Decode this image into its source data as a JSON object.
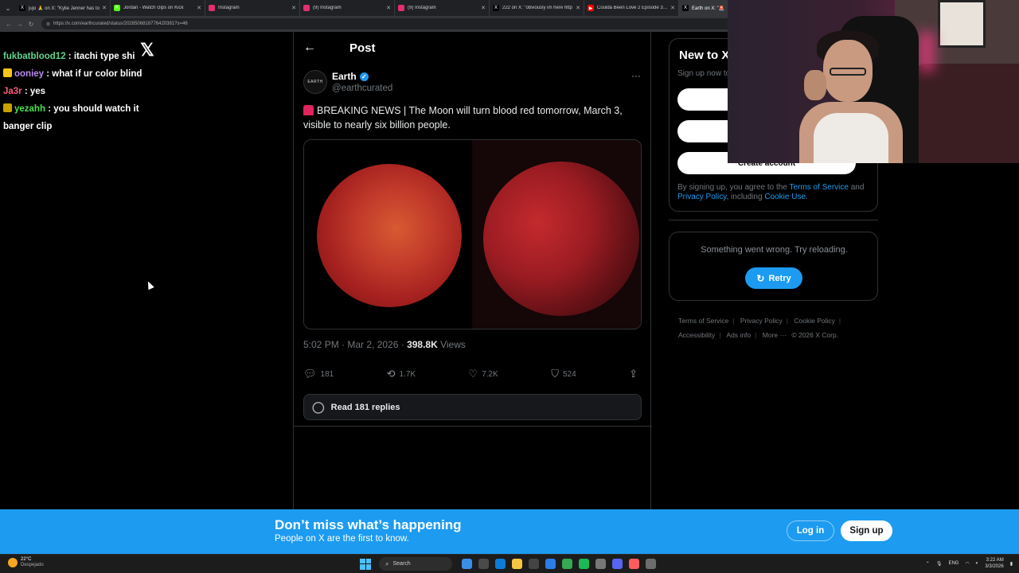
{
  "browser": {
    "tabs": [
      {
        "title": "jujo 🙏 on X: \"Kylie Jenner has to",
        "color": "#000000",
        "glyph": "X"
      },
      {
        "title": "Jordan - Watch clips on Kick",
        "color": "#53fc18",
        "glyph": "K"
      },
      {
        "title": "Instagram",
        "color": "#e1306c",
        "glyph": ""
      },
      {
        "title": "(9) Instagram",
        "color": "#e1306c",
        "glyph": ""
      },
      {
        "title": "(9) Instagram",
        "color": "#e1306c",
        "glyph": ""
      },
      {
        "title": "222 on X: \"obviously im here http",
        "color": "#000000",
        "glyph": "X"
      },
      {
        "title": "Coulda Been Love 2 Episode 3: Bo",
        "color": "#ff0000",
        "glyph": "▶"
      },
      {
        "title": "Earth on X: \"🚨",
        "color": "#000000",
        "glyph": "X"
      }
    ],
    "url": "https://x.com/earthcurated/status/2028506818776420381?s=46"
  },
  "chat": {
    "messages": [
      {
        "user": "fukbatblood12",
        "text": " : itachi type shi",
        "color": "#5fd38d",
        "badge": ""
      },
      {
        "user": "ooniey",
        "text": " : what if ur color blind",
        "color": "#b98cf0",
        "badge": "#f5c518"
      },
      {
        "user": "Ja3r",
        "text": " : yes",
        "color": "#ff5c7c",
        "badge": ""
      },
      {
        "user": "yezahh",
        "text": " : you should watch it banger clip",
        "color": "#4be04b",
        "badge": "#c8a200"
      }
    ]
  },
  "post": {
    "header_title": "Post",
    "author_name": "Earth",
    "author_handle": "@earthcurated",
    "avatar_text": "EARTH",
    "text": "BREAKING NEWS | The Moon will turn blood red tomorrow, March 3, visible to nearly six billion people.",
    "time": "5:02 PM · Mar 2, 2026 · ",
    "views_count": "398.8K",
    "views_label": " Views",
    "actions": {
      "replies": "181",
      "reposts": "1.7K",
      "likes": "7.2K",
      "bookmarks": "524"
    },
    "read_replies": "Read 181 replies"
  },
  "sidebar": {
    "new_title": "New to X",
    "signup_now": "Sign up now to",
    "google_btn": "G",
    "apple_btn": "",
    "create_btn": "Create account",
    "terms_prefix": "By signing up, you agree to the ",
    "terms_link": "Terms of Service",
    "terms_and": " and ",
    "privacy_link": "Privacy Policy",
    "terms_including": ", including ",
    "cookie_link": "Cookie Use",
    "terms_end": ".",
    "error_text": "Something went wrong. Try reloading.",
    "retry": "Retry",
    "footer": {
      "tos": "Terms of Service",
      "privacy": "Privacy Policy",
      "cookie": "Cookie Policy",
      "accessibility": "Accessibility",
      "ads": "Ads info",
      "more": "More ···",
      "copyright": "© 2026 X Corp."
    }
  },
  "banner": {
    "title": "Don’t miss what’s happening",
    "subtitle": "People on X are the first to know.",
    "login": "Log in",
    "signup": "Sign up"
  },
  "taskbar": {
    "temp": "22°C",
    "weather": "Despejado",
    "search": "Search",
    "lang": "ENG",
    "time": "3:22 AM",
    "date": "3/3/2026",
    "apps": [
      "#3a8ee6",
      "#4a4a4a",
      "#0c7cd5",
      "#f7c542",
      "#444444",
      "#2b7de9",
      "#34a853",
      "#1db954",
      "#777777",
      "#5865f2",
      "#fa5c5c",
      "#6d6d6d"
    ]
  }
}
